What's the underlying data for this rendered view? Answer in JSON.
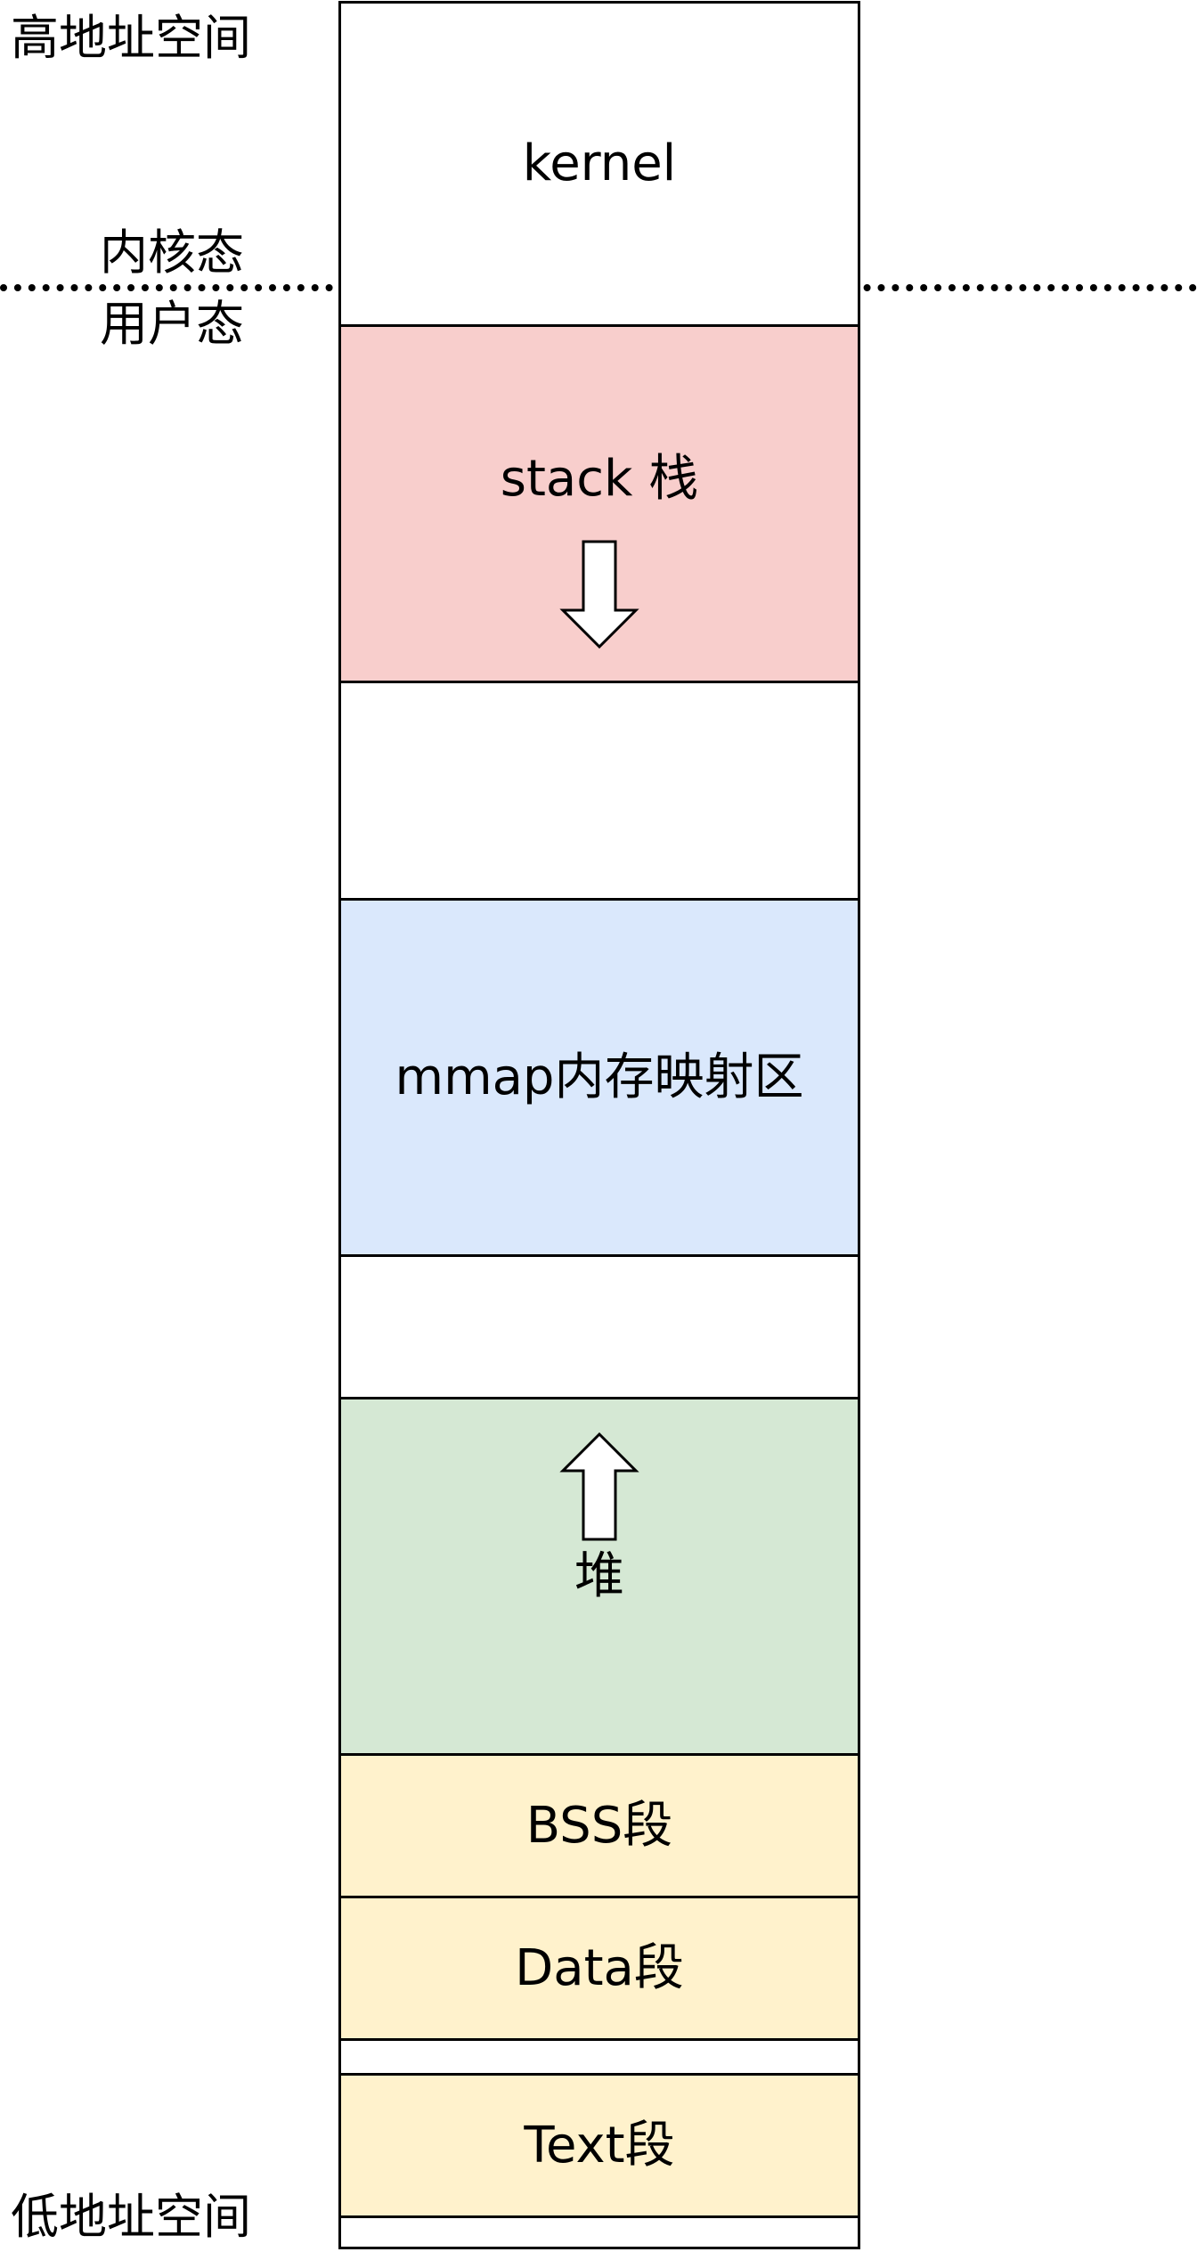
{
  "labels": {
    "high_address": "高地址空间",
    "kernel_mode": "内核态",
    "user_mode": "用户态",
    "low_address": "低地址空间"
  },
  "segments": {
    "kernel": "kernel",
    "stack": "stack 栈",
    "mmap": "mmap内存映射区",
    "heap": "堆",
    "bss": "BSS段",
    "data": "Data段",
    "text": "Text段"
  },
  "colors": {
    "stack": "#f8cecc",
    "mmap": "#dae8fc",
    "heap": "#d5e8d4",
    "static_segments": "#fff2cc",
    "empty": "#ffffff",
    "border": "#000000"
  },
  "arrows": {
    "stack": "arrow-down",
    "heap": "arrow-up"
  }
}
